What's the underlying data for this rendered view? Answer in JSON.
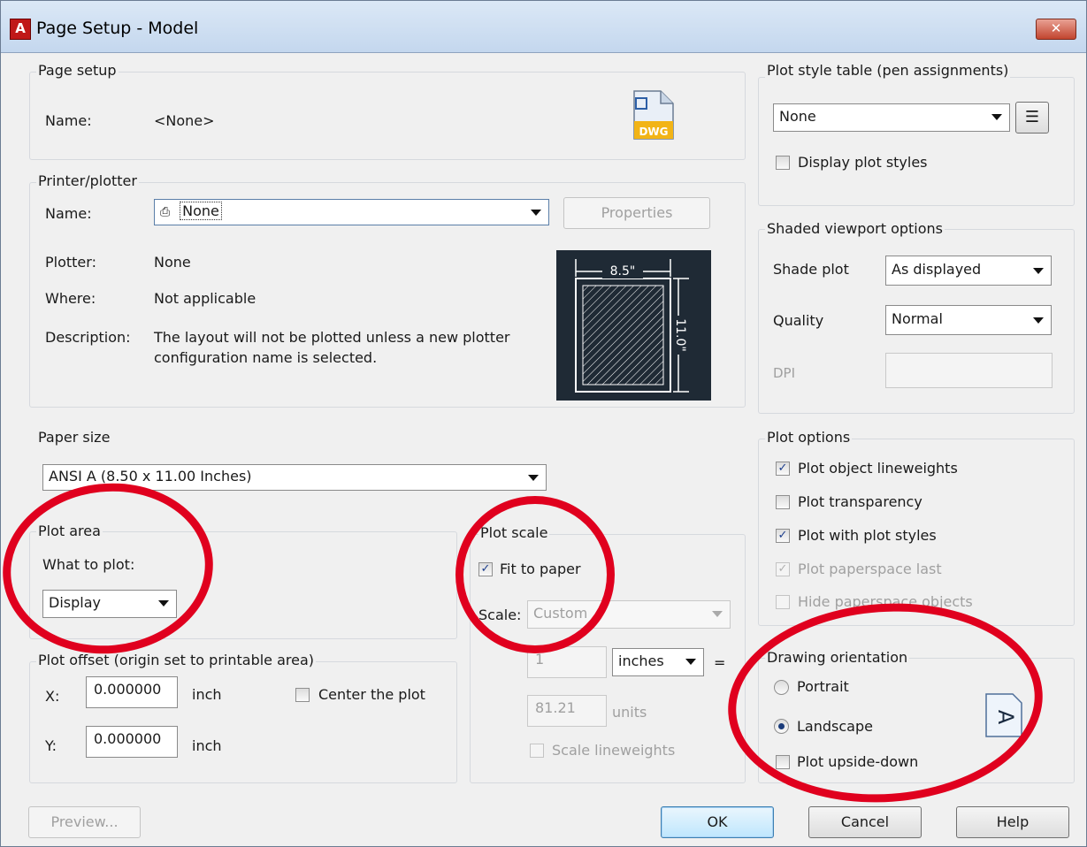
{
  "window": {
    "title": "Page Setup - Model",
    "app_icon": "A",
    "close_glyph": "✕"
  },
  "page_setup": {
    "title": "Page setup",
    "name_label": "Name:",
    "name_value": "<None>",
    "dwg_label": "DWG"
  },
  "printer": {
    "title": "Printer/plotter",
    "name_label": "Name:",
    "name_value": "None",
    "properties_button": "Properties",
    "plotter_label": "Plotter:",
    "plotter_value": "None",
    "where_label": "Where:",
    "where_value": "Not applicable",
    "description_label": "Description:",
    "description_line1": "The layout will not be plotted unless a new plotter",
    "description_line2": "configuration name is selected.",
    "preview_width": "8.5\"",
    "preview_height": "11.0\""
  },
  "paper_size": {
    "title": "Paper size",
    "value": "ANSI A (8.50 x 11.00 Inches)"
  },
  "plot_area": {
    "title": "Plot area",
    "what_label": "What to plot:",
    "what_value": "Display"
  },
  "plot_offset": {
    "title": "Plot offset (origin set to printable area)",
    "x_label": "X:",
    "x_value": "0.000000",
    "x_unit": "inch",
    "y_label": "Y:",
    "y_value": "0.000000",
    "y_unit": "inch",
    "center_label": "Center the plot"
  },
  "plot_scale": {
    "title": "Plot scale",
    "fit_label": "Fit to paper",
    "scale_label": "Scale:",
    "scale_value": "Custom",
    "value1": "1",
    "unit1": "inches",
    "equals": "=",
    "value2": "81.21",
    "unit2": "units",
    "lineweights_label": "Scale lineweights"
  },
  "plot_style_table": {
    "title": "Plot style table (pen assignments)",
    "value": "None",
    "display_label": "Display plot styles"
  },
  "shaded_viewport": {
    "title": "Shaded viewport options",
    "shade_label": "Shade plot",
    "shade_value": "As displayed",
    "quality_label": "Quality",
    "quality_value": "Normal",
    "dpi_label": "DPI"
  },
  "plot_options": {
    "title": "Plot options",
    "items": [
      {
        "label": "Plot object lineweights",
        "mark": "✓"
      },
      {
        "label": "Plot transparency",
        "mark": ""
      },
      {
        "label": "Plot with plot styles",
        "mark": "✓"
      },
      {
        "label": "Plot paperspace last",
        "mark": "✓"
      },
      {
        "label": "Hide paperspace objects",
        "mark": ""
      }
    ]
  },
  "orientation": {
    "title": "Drawing orientation",
    "portrait": "Portrait",
    "landscape": "Landscape",
    "upside_down": "Plot upside-down",
    "preview_glyph": "A"
  },
  "buttons": {
    "preview": "Preview...",
    "ok": "OK",
    "cancel": "Cancel",
    "help": "Help"
  },
  "colors": {
    "annotation_red": "#e0001e",
    "titlebar": "#c4d7ee",
    "dialog_bg": "#f0f0f0"
  }
}
